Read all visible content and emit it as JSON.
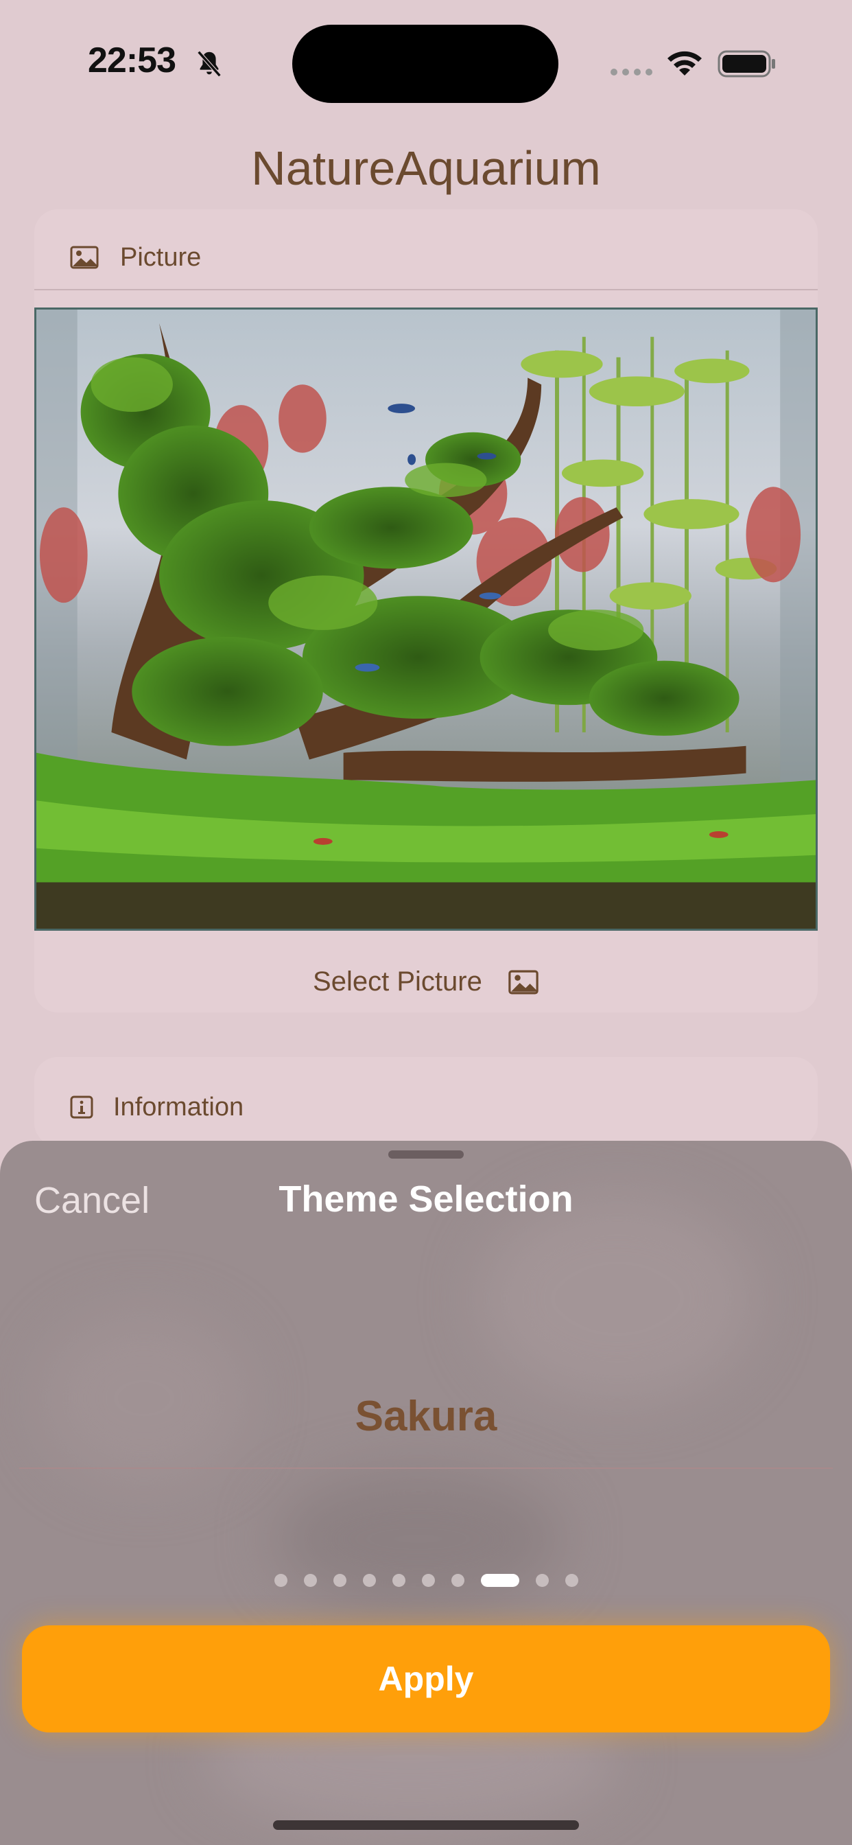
{
  "status_bar": {
    "time": "22:53",
    "icons": [
      "bell-slash-icon",
      "signal-icon",
      "wifi-icon",
      "battery-icon"
    ]
  },
  "app": {
    "title": "NatureAquarium"
  },
  "picture_card": {
    "header_icon": "photo-icon",
    "header_label": "Picture",
    "select_label": "Select Picture",
    "select_icon": "photo-icon"
  },
  "info_card": {
    "header_icon": "info-square-icon",
    "header_label": "Information"
  },
  "sheet": {
    "cancel_label": "Cancel",
    "title": "Theme Selection",
    "selected_theme": "Sakura",
    "page_count": 10,
    "current_page": 8,
    "apply_label": "Apply"
  },
  "colors": {
    "background": "#e0cbd0",
    "text_brown": "#6b4a2f",
    "accent_orange": "#ff9f0a",
    "sheet_bg": "#9a8d8f"
  }
}
